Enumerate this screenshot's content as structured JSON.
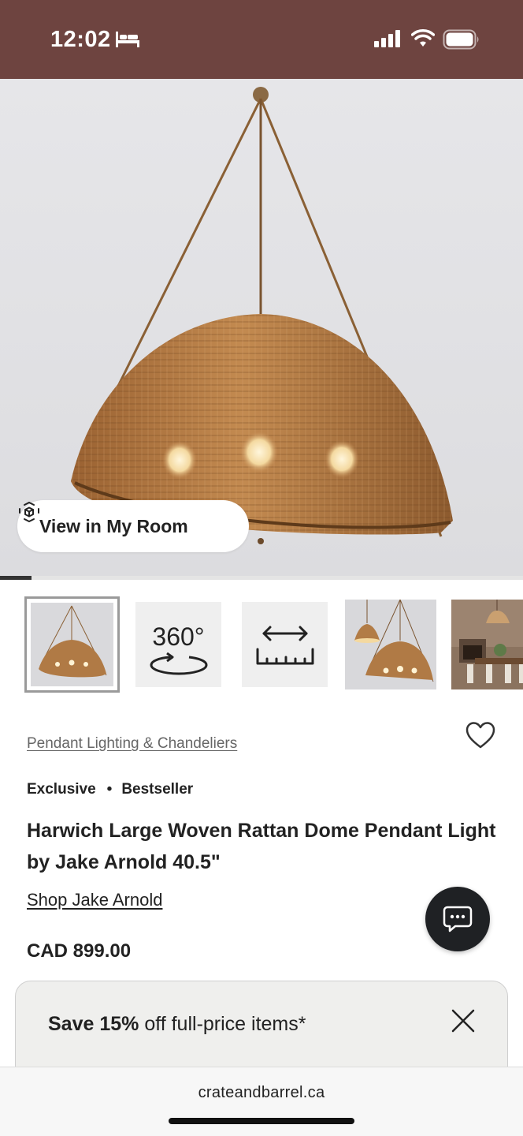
{
  "status_bar": {
    "time": "12:02",
    "background": "#6e4440",
    "icons": [
      "bed-icon",
      "signal-icon",
      "wifi-icon",
      "battery-icon"
    ]
  },
  "hero": {
    "ar_button_label": "View in My Room",
    "ar_icon": "ar-cube-icon",
    "gallery_progress": 0.06
  },
  "thumbnails": [
    {
      "type": "image",
      "description_icon": "pendant-photo",
      "selected": true
    },
    {
      "type": "360",
      "label": "360°"
    },
    {
      "type": "dimensions",
      "icon": "ruler-arrows-icon"
    },
    {
      "type": "image",
      "description_icon": "pendant-pair-photo",
      "selected": false
    },
    {
      "type": "image",
      "description_icon": "dining-room-photo",
      "selected": false
    }
  ],
  "product": {
    "category": "Pendant Lighting & Chandeliers",
    "badges": [
      "Exclusive",
      "Bestseller"
    ],
    "badge_separator": "•",
    "title": "Harwich Large Woven Rattan Dome Pendant Light by Jake Arnold 40.5\"",
    "brand_link": "Shop Jake Arnold",
    "price": "CAD 899.00"
  },
  "promo": {
    "bold_prefix": "Save 15%",
    "text": " off full-price items*"
  },
  "browser": {
    "url": "crateandbarrel.ca"
  },
  "colors": {
    "brand_dark": "#222222",
    "rattan": "#b07a45",
    "chat_bg": "#1f2124"
  }
}
